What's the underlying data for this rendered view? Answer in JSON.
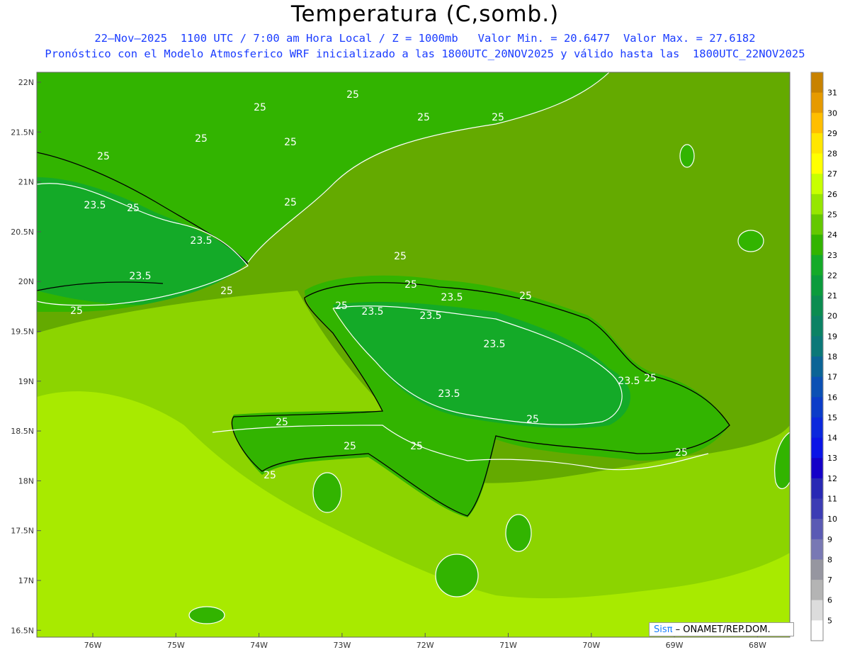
{
  "header": {
    "title": "Temperatura (C,somb.)",
    "line1": "22–Nov–2025  1100 UTC / 7:00 am Hora Local / Z = 1000mb   Valor Min. = 20.6477  Valor Max. = 27.6182",
    "line2": "Pronóstico con el Modelo Atmosferico WRF inicializado a las 1800UTC_20NOV2025 y válido hasta las  1800UTC_22NOV2025"
  },
  "lat_labels": [
    "22N",
    "21.5N",
    "21N",
    "20.5N",
    "20N",
    "19.5N",
    "19N",
    "18.5N",
    "18N",
    "17.5N",
    "17N",
    "16.5N"
  ],
  "lon_labels": [
    "76W",
    "75W",
    "74W",
    "73W",
    "72W",
    "71W",
    "70W",
    "69W",
    "68W"
  ],
  "colorbar": {
    "levels": [
      "31",
      "30",
      "29",
      "28",
      "27",
      "26",
      "25",
      "24",
      "23",
      "22",
      "21",
      "20",
      "19",
      "18",
      "17",
      "16",
      "15",
      "14",
      "13",
      "12",
      "11",
      "10",
      "9",
      "8",
      "7",
      "6",
      "5"
    ],
    "colors": [
      "#c88200",
      "#e69a00",
      "#ffbe00",
      "#ffe600",
      "#ffff00",
      "#c8ff00",
      "#96e600",
      "#64c800",
      "#32b400",
      "#14aa28",
      "#0a9b3c",
      "#0a8c50",
      "#0a8264",
      "#0a7878",
      "#0a6496",
      "#0a50b4",
      "#0a3cc8",
      "#0a28dc",
      "#0a14e6",
      "#1400c8",
      "#2828b4",
      "#3c3cb4",
      "#5a5ab4",
      "#7878b4",
      "#9696a0",
      "#b4b4b4",
      "#dcdcdc",
      "#ffffff"
    ]
  },
  "contour_labels": [
    "25",
    "25",
    "25",
    "25",
    "25",
    "25",
    "25",
    "25",
    "23.5",
    "25",
    "23.5",
    "23.5",
    "25",
    "25",
    "25",
    "25",
    "23.5",
    "25",
    "23.5",
    "23.5",
    "23.5",
    "23.5",
    "25",
    "23.5",
    "25",
    "25",
    "25",
    "25",
    "25",
    "25",
    "25"
  ],
  "credit": {
    "brand": "Sisπ",
    "text": " – ONAMET/REP.DOM."
  }
}
